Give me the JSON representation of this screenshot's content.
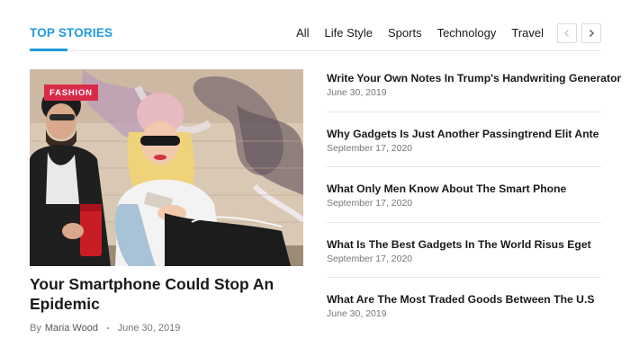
{
  "header": {
    "title": "TOP STORIES",
    "tabs": [
      {
        "label": "All"
      },
      {
        "label": "Life Style"
      },
      {
        "label": "Sports"
      },
      {
        "label": "Technology"
      },
      {
        "label": "Travel"
      }
    ],
    "prev_icon": "chevron-left-icon",
    "next_icon": "chevron-right-icon"
  },
  "featured": {
    "category": "FASHION",
    "title": "Your Smartphone Could Stop An Epidemic",
    "by": "By",
    "author": "Maria Wood",
    "separator": "-",
    "date": "June 30, 2019",
    "image": "photo of a couple sitting against a graffiti wall looking at a smartphone"
  },
  "stories": [
    {
      "title": "Write Your Own Notes In Trump's Handwriting Generator",
      "date": "June 30, 2019"
    },
    {
      "title": "Why Gadgets Is Just Another Passingtrend Elit Ante",
      "date": "September 17, 2020"
    },
    {
      "title": "What Only Men Know About The Smart Phone",
      "date": "September 17, 2020"
    },
    {
      "title": "What Is The Best Gadgets In The World Risus Eget",
      "date": "September 17, 2020"
    },
    {
      "title": "What Are The Most Traded Goods Between The U.S",
      "date": "June 30, 2019"
    }
  ],
  "colors": {
    "accent": "#1e9be0",
    "badge": "#d92a4a"
  }
}
